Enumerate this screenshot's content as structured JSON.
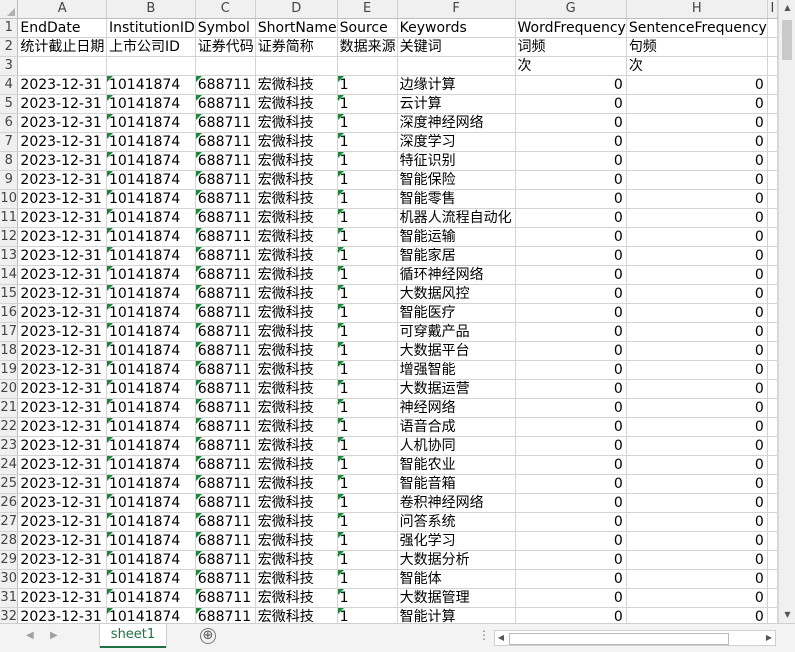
{
  "columns": [
    "A",
    "B",
    "C",
    "D",
    "E",
    "F",
    "G",
    "H",
    "I"
  ],
  "header_row1": [
    "EndDate",
    "InstitutionID",
    "Symbol",
    "ShortName",
    "Source",
    "Keywords",
    "WordFrequency",
    "SentenceFrequency",
    ""
  ],
  "header_row2": [
    "统计截止日期",
    "上市公司ID",
    "证券代码",
    "证券简称",
    "数据来源",
    "关键词",
    "词频",
    "句频",
    ""
  ],
  "header_row3": [
    "",
    "",
    "",
    "",
    "",
    "",
    "次",
    "次",
    ""
  ],
  "record_common": {
    "end_date": "2023-12-31",
    "institution_id": "10141874",
    "symbol": "688711",
    "short_name": "宏微科技",
    "source": "1",
    "word_freq": "0",
    "sentence_freq": "0"
  },
  "keywords": [
    "边缘计算",
    "云计算",
    "深度神经网络",
    "深度学习",
    "特征识别",
    "智能保险",
    "智能零售",
    "机器人流程自动化",
    "智能运输",
    "智能家居",
    "循环神经网络",
    "大数据风控",
    "智能医疗",
    "可穿戴产品",
    "大数据平台",
    "增强智能",
    "大数据运营",
    "神经网络",
    "语音合成",
    "人机协同",
    "智能农业",
    "智能音箱",
    "卷积神经网络",
    "问答系统",
    "强化学习",
    "大数据分析",
    "智能体",
    "大数据管理",
    "智能计算"
  ],
  "sheet_tab": "sheet1",
  "add_sheet_symbol": "⊕",
  "nav_prev": "◀",
  "nav_next": "▶",
  "hscroll_dots": "⋮",
  "colors": {
    "accent": "#1e7145",
    "flag": "#1a8a3a"
  }
}
